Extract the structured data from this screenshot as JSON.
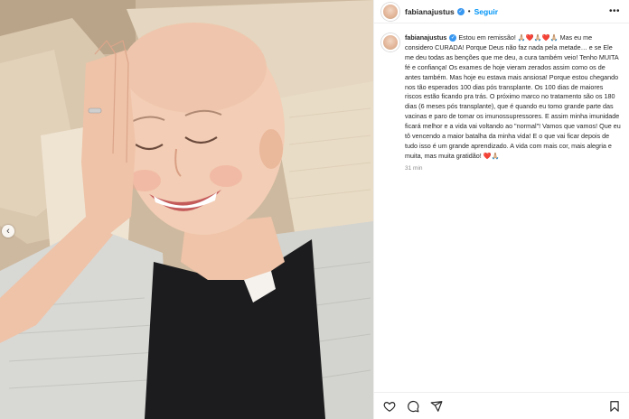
{
  "post": {
    "username": "fabianajustus",
    "follow_label": "Seguir",
    "separator": "•",
    "more_label": "•••",
    "caption_text": "Estou em remissão! 🙏🏼❤️🙏🏼❤️🙏🏼 Mas eu me considero CURADA! Porque Deus não faz nada pela metade… e se Ele me deu todas as benções que me deu, a cura também veio! Tenho MUITA fé e confiança! Os exames de hoje vieram zerados assim como os de antes também. Mas hoje eu estava mais ansiosa! Porque estou chegando nos tão esperados 100 dias pós transplante. Os 100 dias de maiores riscos estão ficando pra trás. O próximo marco no tratamento são os 180 dias (6 meses pós transplante), que é quando eu tomo grande parte das vacinas e paro de tomar os imunossupressores. E assim minha imunidade ficará melhor e a vida vai voltando ao \"normal\"! Vamos que vamos! Que eu tô vencendo a maior batalha da minha vida! E o que vai ficar depois de tudo isso é um grande aprendizado. A vida com mais cor, mais alegria e muita, mas muita gratidão! ❤️🙏🏼",
    "timestamp": "31 min"
  },
  "photo": {
    "carousel_prev": "‹"
  },
  "icons": {
    "like": "heart-icon",
    "comment": "comment-icon",
    "share": "share-icon",
    "save": "bookmark-icon",
    "carousel_prev": "chevron-left-icon",
    "more": "more-options-icon",
    "verified": "verified-badge-icon"
  },
  "colors": {
    "follow_blue": "#0095f6",
    "verified_blue": "#3897f0",
    "text": "#262626",
    "muted": "#8e8e8e"
  }
}
